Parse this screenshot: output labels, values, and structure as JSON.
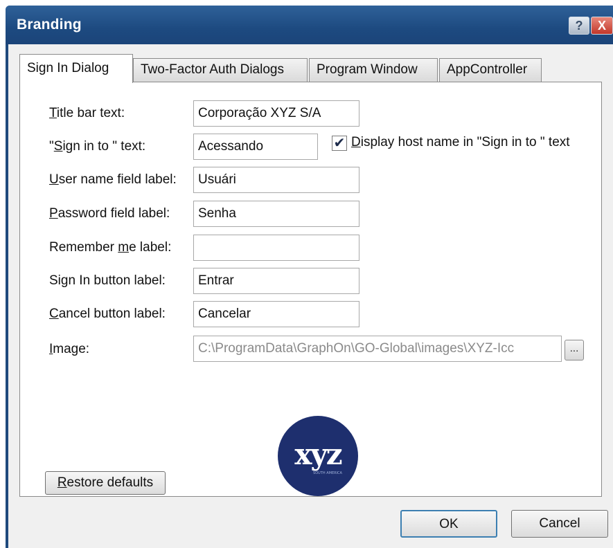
{
  "window": {
    "title": "Branding",
    "help_button": "?",
    "close_button": "X"
  },
  "tabs": [
    {
      "label": "Sign In Dialog",
      "active": true
    },
    {
      "label": "Two-Factor Auth Dialogs",
      "active": false
    },
    {
      "label": "Program Window",
      "active": false
    },
    {
      "label": "AppController",
      "active": false
    }
  ],
  "form": {
    "title_bar": {
      "label_u": "T",
      "label_rest": "itle bar text:",
      "value": "Corporação XYZ S/A"
    },
    "sign_in_to": {
      "label_pre": "\"",
      "label_u": "S",
      "label_rest": "ign in to \" text:",
      "value": "Acessando"
    },
    "display_host": {
      "checked": true,
      "label_u": "D",
      "label_rest": "isplay host name in \"Sign in to \" text"
    },
    "user_name": {
      "label_u": "U",
      "label_rest": "ser name field label:",
      "value": "Usuári"
    },
    "password": {
      "label_u": "P",
      "label_rest": "assword field label:",
      "value": "Senha"
    },
    "remember_me": {
      "label_pre": "Remember ",
      "label_u": "m",
      "label_rest": "e label:",
      "value": ""
    },
    "sign_in_button": {
      "label": "Sign In button label:",
      "value": "Entrar"
    },
    "cancel_button": {
      "label_u": "C",
      "label_rest": "ancel button label:",
      "value": "Cancelar"
    },
    "image": {
      "label_u": "I",
      "label_rest": "mage:",
      "value": "C:\\ProgramData\\GraphOn\\GO-Global\\images\\XYZ-Icc",
      "browse": "..."
    }
  },
  "logo": {
    "text": "XYZ",
    "subtext": "SOUTH AMERICA",
    "color": "#1e2f6e"
  },
  "buttons": {
    "restore_u": "R",
    "restore_rest": "estore defaults",
    "ok": "OK",
    "cancel": "Cancel"
  },
  "colors": {
    "titlebar": "#1d4a80",
    "accent": "#3c7fb1"
  }
}
